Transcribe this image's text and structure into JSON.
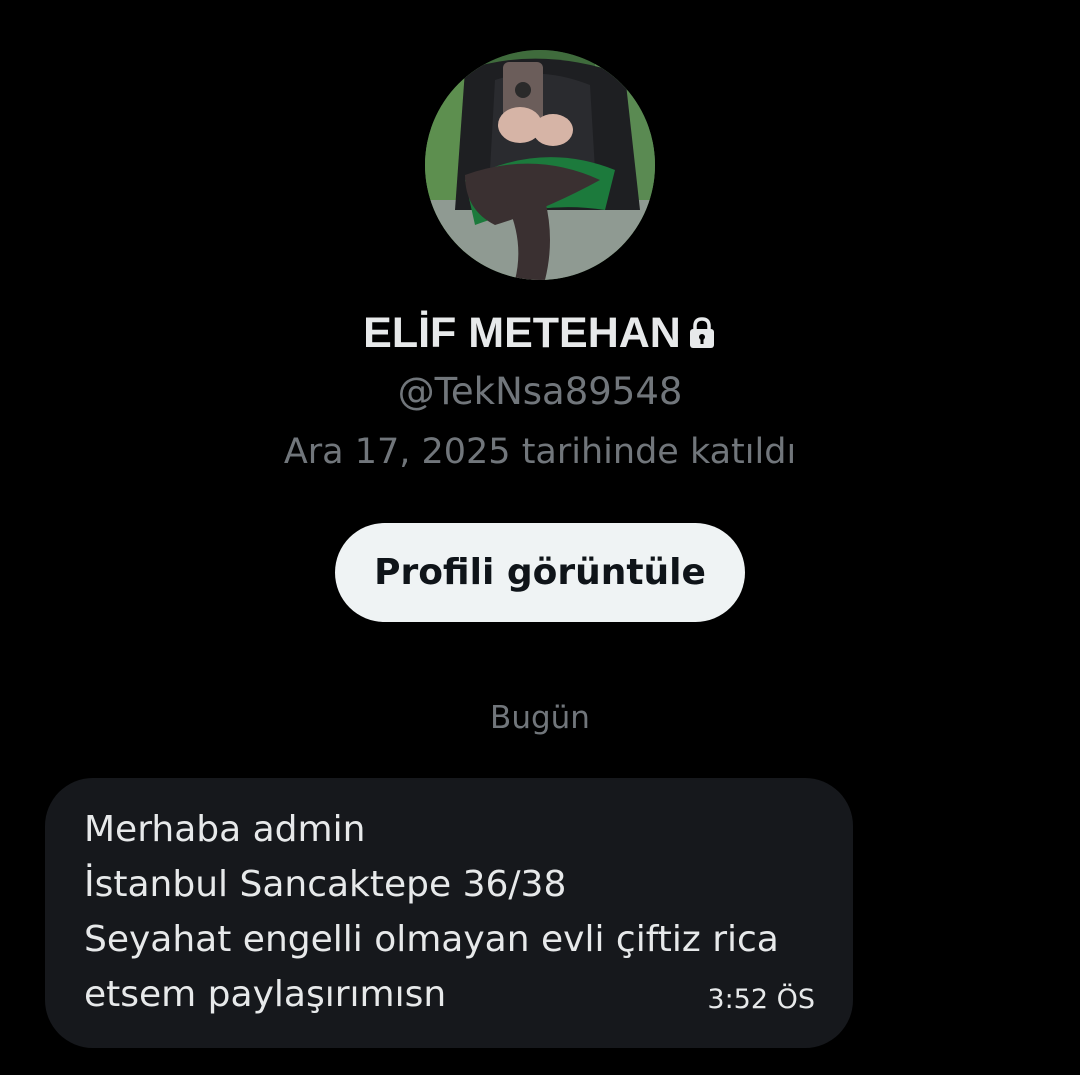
{
  "profile": {
    "display_name": "ELİF METEHAN",
    "handle": "@TekNsa89548",
    "joined": "Ara 17, 2025 tarihinde katıldı",
    "locked_icon": "lock-icon",
    "avatar_icon": "avatar-photo"
  },
  "actions": {
    "view_profile_label": "Profili görüntüle"
  },
  "conversation": {
    "date_separator": "Bugün",
    "messages": [
      {
        "lines": [
          "Merhaba admin",
          "İstanbul Sancaktepe 36/38",
          "Seyahat engelli olmayan evli çiftiz rica",
          "etsem paylaşırımısn"
        ],
        "time": "3:52 ÖS"
      }
    ]
  },
  "colors": {
    "background": "#000000",
    "primary_text": "#e7e9ea",
    "secondary_text": "#71767b",
    "button_bg": "#eff3f4",
    "button_text": "#0f1419",
    "bubble_bg": "#16181c"
  }
}
